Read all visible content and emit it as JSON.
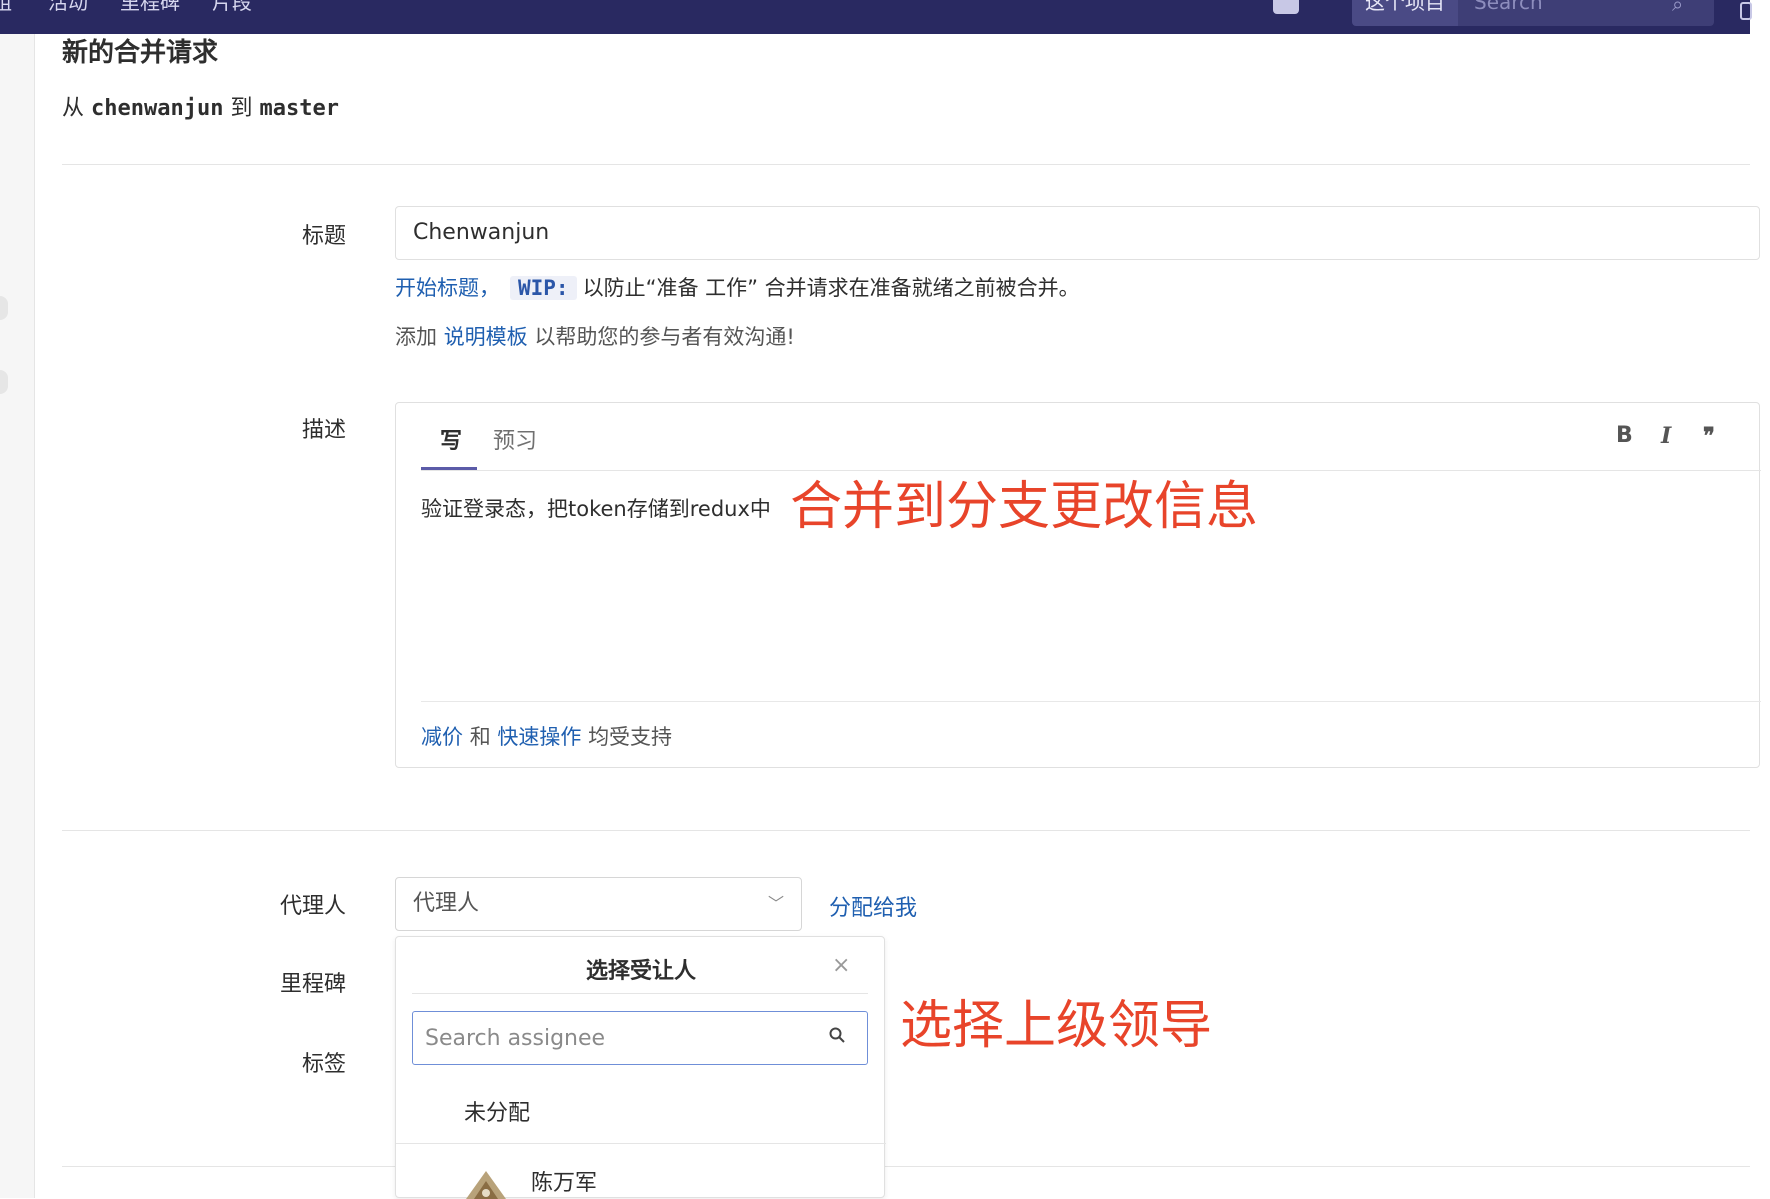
{
  "topnav": {
    "items": [
      "组",
      "活动",
      "里程碑",
      "片段"
    ],
    "scope_label": "这个项目",
    "search_placeholder": "Search"
  },
  "page": {
    "title": "新的合并请求",
    "from_word": "从",
    "source_branch": "chenwanjun",
    "to_word": "到",
    "target_branch": "master"
  },
  "form": {
    "title_label": "标题",
    "title_value": "Chenwanjun",
    "wip_hint": {
      "link": "开始标题，",
      "code": "WIP:",
      "rest": "以防止“准备 工作” 合并请求在准备就绪之前被合并。"
    },
    "template_hint": {
      "prefix": "添加",
      "link": "说明模板",
      "suffix": "以帮助您的参与者有效沟通!"
    },
    "description_label": "描述",
    "editor": {
      "tab_write": "写",
      "tab_preview": "预习",
      "bold": "B",
      "italic": "I",
      "quote": "❞",
      "content": "验证登录态，把token存储到redux中",
      "footer_link1": "减价",
      "footer_and": "和",
      "footer_link2": "快速操作",
      "footer_suffix": "均受支持"
    },
    "assignee_label": "代理人",
    "assignee_placeholder": "代理人",
    "assign_to_me": "分配给我",
    "milestone_label": "里程碑",
    "labels_label": "标签"
  },
  "assignee_dropdown": {
    "title": "选择受让人",
    "close": "×",
    "search_placeholder": "Search assignee",
    "unassigned": "未分配",
    "users": [
      {
        "name": "陈万军"
      }
    ]
  },
  "annotations": {
    "description_note": "合并到分支更改信息",
    "assignee_note": "选择上级领导",
    "color": "#e8442a"
  },
  "colors": {
    "topbar": "#292961",
    "link": "#1f5fb0",
    "tab_active": "#5b5ba8"
  }
}
